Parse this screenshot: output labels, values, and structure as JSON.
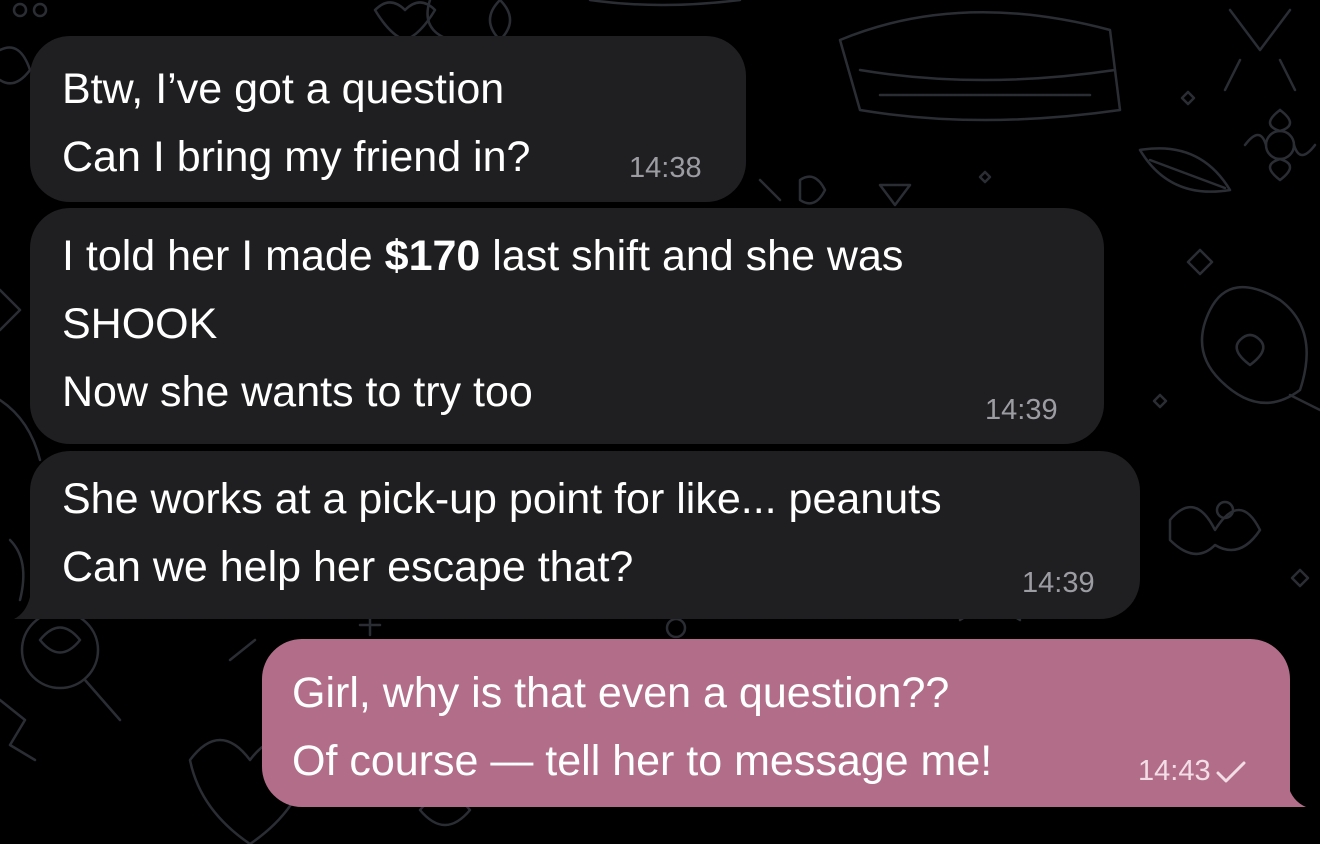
{
  "chat": {
    "colors": {
      "background": "#000000",
      "incoming_bubble": "#1f1f22",
      "outgoing_bubble": "#b26e89",
      "incoming_time": "#9c9ca3",
      "text": "#ffffff"
    },
    "messages": [
      {
        "direction": "incoming",
        "lines": [
          "Btw, I’ve got a question",
          "Can I bring my friend in?"
        ],
        "time": "14:38"
      },
      {
        "direction": "incoming",
        "line1_before": "I told her I made ",
        "line1_bold": "$170",
        "line1_after": " last shift and she was",
        "lines": [
          "SHOOK",
          "Now she wants to try too"
        ],
        "time": "14:39"
      },
      {
        "direction": "incoming",
        "lines": [
          "She works at a pick-up point for like... peanuts",
          "Can we help her escape that?"
        ],
        "time": "14:39"
      },
      {
        "direction": "outgoing",
        "lines": [
          "Girl, why is that even a question??",
          "Of course — tell her to message me!"
        ],
        "time": "14:43",
        "status_icon": "single-check-icon"
      }
    ]
  }
}
